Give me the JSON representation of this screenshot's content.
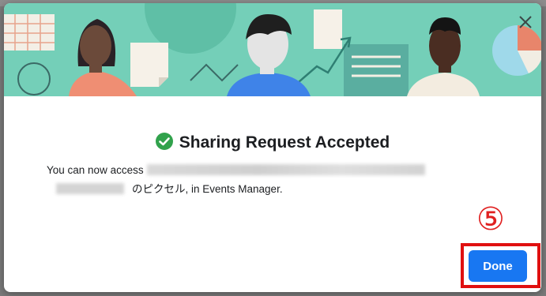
{
  "dialog": {
    "close_icon": "close-icon",
    "title_icon": "check-circle-icon",
    "title": "Sharing Request Accepted",
    "message_prefix": "You can now access",
    "message_suffix": "のピクセル, in Events Manager.",
    "done_label": "Done",
    "annotation_number": "⑤"
  },
  "colors": {
    "hero_bg": "#74cfb8",
    "accent": "#1877f2",
    "success": "#31a24c",
    "annotation": "#e01010"
  }
}
